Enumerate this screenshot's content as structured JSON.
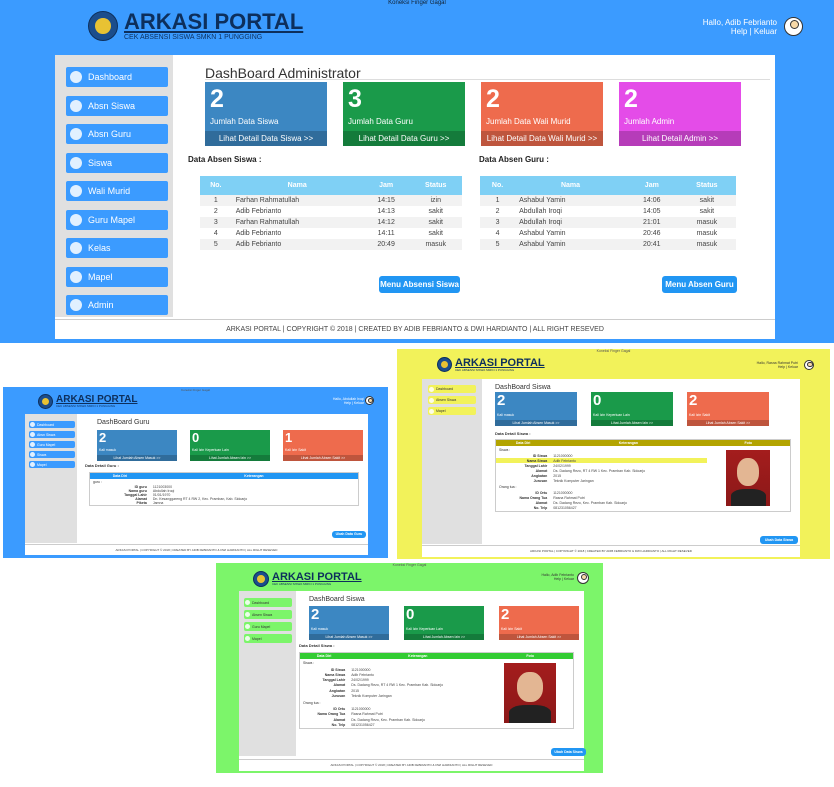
{
  "main": {
    "top_note": "Koneksi Finger Gagal",
    "brand_title": "ARKASI PORTAL",
    "brand_sub": "CEK ABSENSI SISWA SMKN 1 PUNGGING",
    "hello": "Hallo, Adib Febrianto",
    "help_links": "Help | Keluar",
    "page_title": "DashBoard Administrator",
    "sidebar": [
      "Dashboard",
      "Absn Siswa",
      "Absn Guru",
      "Siswa",
      "Wali Murid",
      "Guru Mapel",
      "Kelas",
      "Mapel",
      "Admin"
    ],
    "cards": [
      {
        "num": "2",
        "label": "Jumlah Data Siswa",
        "link": "Lihat Detail Data Siswa >>",
        "color": "#3c87c2"
      },
      {
        "num": "3",
        "label": "Jumlah Data Guru",
        "link": "Lihat Detail Data Guru >>",
        "color": "#1a9a4a"
      },
      {
        "num": "2",
        "label": "Jumlah Data Wali Murid",
        "link": "Lihat Detail Data Wali Murid >>",
        "color": "#ee6b4d"
      },
      {
        "num": "2",
        "label": "Jumlah Admin",
        "link": "Lihat Detail Admin >>",
        "color": "#e44ce8"
      }
    ],
    "siswa_title": "Data Absen Siswa :",
    "guru_title": "Data Absen Guru :",
    "headers": [
      "No.",
      "Nama",
      "Jam",
      "Status"
    ],
    "siswa_rows": [
      [
        "1",
        "Farhan Rahmatullah",
        "14:15",
        "izin"
      ],
      [
        "2",
        "Adib Febrianto",
        "14:13",
        "sakit"
      ],
      [
        "3",
        "Farhan Rahmatullah",
        "14:12",
        "sakit"
      ],
      [
        "4",
        "Adib Febrianto",
        "14:11",
        "sakit"
      ],
      [
        "5",
        "Adib Febrianto",
        "20:49",
        "masuk"
      ]
    ],
    "guru_rows": [
      [
        "1",
        "Ashabul Yamin",
        "14:06",
        "sakit"
      ],
      [
        "2",
        "Abdullah Iroqi",
        "14:05",
        "sakit"
      ],
      [
        "3",
        "Abdullah Iroqi",
        "21:01",
        "masuk"
      ],
      [
        "4",
        "Ashabul Yamin",
        "20:46",
        "masuk"
      ],
      [
        "5",
        "Ashabul Yamin",
        "20:41",
        "masuk"
      ]
    ],
    "btn_siswa": "Menu Absensi Siswa",
    "btn_guru": "Menu Absen Guru",
    "footer": "ARKASI PORTAL | COPYRIGHT © 2018 | CREATED BY ADIB FEBRIANTO & DWI HARDIANTO | ALL RIGHT RESEVED"
  },
  "guru": {
    "top_note": "Koneksi Finger Gagal",
    "brand_title": "ARKASI PORTAL",
    "brand_sub": "CEK ABSENSI SISWA SMKN 1 PUNGGING",
    "hello": "Hallo, Abdullah Iroqi",
    "help_links": "Help | Keluar",
    "page_title": "DashBoard Guru",
    "sidebar": [
      "Dashboard",
      "Absn Siswa",
      "Guru Mapel",
      "Siswa",
      "Mapel"
    ],
    "cards": [
      {
        "num": "2",
        "label": "Kali masuk",
        "link": "Lihat Jumlah Absen Masuk >>",
        "color": "#3c87c2"
      },
      {
        "num": "0",
        "label": "Kali Izin Keperluan Lain",
        "link": "Lihat Jumlah Absen Izin >>",
        "color": "#1a9a4a"
      },
      {
        "num": "1",
        "label": "Kali Izin Sakit",
        "link": "Lihat Jumlah Absen Sakit >>",
        "color": "#ee6b4d"
      }
    ],
    "detail_title": "Data Detail Guru :",
    "col_left": "Data Diri",
    "col_right": "Keterangan",
    "section": "guru :",
    "fields": [
      [
        "ID guru",
        "1121003000"
      ],
      [
        "Nama guru",
        "Abdullah Iroqi"
      ],
      [
        "Tanggal Lahir",
        "01/01/1970"
      ],
      [
        "Alamat",
        "Dn. Kesanggareng RT 4 RW 2, Kec. Pramban, Kab. Sidoarjo"
      ],
      [
        "Piketa",
        "Jamna"
      ]
    ],
    "btn": "Ubah Data Guru",
    "footer": "ARKASI PORTAL | COPYRIGHT © 2018 | CREATED BY ADIB FEBRIANTO & DWI HARDIANTO | ALL RIGHT RESEVED"
  },
  "siswa_yellow": {
    "top_note": "Koneksi Finger Gagal",
    "brand_title": "ARKASI PORTAL",
    "brand_sub": "CEK ABSENSI SISWA SMKN 1 PUNGGING",
    "hello": "Hallo, Rasna Rahmat Putri",
    "help_links": "Help | Keluar",
    "page_title": "DashBoard Siswa",
    "sidebar": [
      "Dashboard",
      "Absen Siswa",
      "Mapel"
    ],
    "cards": [
      {
        "num": "2",
        "label": "Kali masuk",
        "link": "Lihat Jumlah Absen Masuk >>",
        "color": "#3c87c2"
      },
      {
        "num": "0",
        "label": "Kali Izin Keperluan Lain",
        "link": "Lihat Jumlah Absen Izin >>",
        "color": "#1a9a4a"
      },
      {
        "num": "2",
        "label": "Kali Izin Sakit",
        "link": "Lihat Jumlah Absen Sakit >>",
        "color": "#ee6b4d"
      }
    ],
    "detail_title": "Data Detail Siswa :",
    "cols": [
      "Data Diri",
      "Keterangan",
      "Foto"
    ],
    "section1": "Siswa :",
    "fields1": [
      [
        "ID Siswa",
        "1121000000"
      ],
      [
        "Nama Siswa",
        "Adib Febrianto"
      ],
      [
        "Tanggal Lahir",
        "24/02/1999"
      ],
      [
        "Alamat",
        "Ds. Dadang Rezo, RT 4 RW 1 Kec. Pramban Kab. Sidoarjo"
      ],
      [
        "Angkatan",
        "2015"
      ],
      [
        "Jurusan",
        "Teknik Komputer Jaringan"
      ]
    ],
    "section2": "Orang tua :",
    "fields2": [
      [
        "ID Ortu",
        "1121000000"
      ],
      [
        "Nama Orang Tua",
        "Rasna Rahmat Putri"
      ],
      [
        "Alamat",
        "Ds. Dadang Rezo, Kec. Pramban Kab. Sidoarjo"
      ],
      [
        "No. Telp",
        "081231056427"
      ]
    ],
    "btn": "Ubah Data Siswa",
    "footer": "ARKASI PORTAL | COPYRIGHT © 2018 | CREATED BY ADIB FEBRIANTO & DWI HARDIANTO | ALL RIGHT RESEVED"
  },
  "siswa_green": {
    "top_note": "Koneksi Finger Gagal",
    "brand_title": "ARKASI PORTAL",
    "brand_sub": "CEK ABSENSI SISWA SMKN 1 PUNGGING",
    "hello": "Hallo, Adib Febrianto",
    "help_links": "Help | Keluar",
    "page_title": "DashBoard Siswa",
    "sidebar": [
      "Dashboard",
      "Absen Siswa",
      "Guru Mapel",
      "Mapel"
    ],
    "cards": [
      {
        "num": "2",
        "label": "Kali masuk",
        "link": "Lihat Jumlah Absen Masuk >>",
        "color": "#3c87c2"
      },
      {
        "num": "0",
        "label": "Kali Izin Keperluan Lain",
        "link": "Lihat Jumlah Absen Izin >>",
        "color": "#1a9a4a"
      },
      {
        "num": "2",
        "label": "Kali Izin Sakit",
        "link": "Lihat Jumlah Absen Sakit >>",
        "color": "#ee6b4d"
      }
    ],
    "detail_title": "Data Detail Siswa :",
    "cols": [
      "Data Diri",
      "Keterangan",
      "Foto"
    ],
    "section1": "Siswa :",
    "fields1": [
      [
        "ID Siswa",
        "1121000000"
      ],
      [
        "Nama Siswa",
        "Adib Febrianto"
      ],
      [
        "Tanggal Lahir",
        "24/02/1999"
      ],
      [
        "Alamat",
        "Ds. Dadang Rezo, RT 4 RW 1 Kec. Pramban Kab. Sidoarjo"
      ],
      [
        "Angkatan",
        "2015"
      ],
      [
        "Jurusan",
        "Teknik Komputer Jaringan"
      ]
    ],
    "section2": "Orang tua :",
    "fields2": [
      [
        "ID Ortu",
        "1121000000"
      ],
      [
        "Nama Orang Tua",
        "Rasna Rahmat Putri"
      ],
      [
        "Alamat",
        "Ds. Dadang Rezo, Kec. Pramban Kab. Sidoarjo"
      ],
      [
        "No. Telp",
        "081231056427"
      ]
    ],
    "btn": "Ubah Data Siswa",
    "footer": "ARKASI PORTAL | COPYRIGHT © 2018 | CREATED BY ADIB FEBRIANTO & DWI HARDIANTO | ALL RIGHT RESEVED"
  },
  "colors": {
    "admin_header": "#3b9bff",
    "guru_header": "#3b9bff",
    "yellow_header": "#f2f25a",
    "green_header": "#7cf56a",
    "table_head": "#7fd0f5",
    "sidebar_blue": "#3b9bff",
    "sidebar_yellow": "#f2f25a",
    "sidebar_green": "#7cf56a",
    "olive_head": "#b3a400",
    "button": "#2196f3"
  }
}
